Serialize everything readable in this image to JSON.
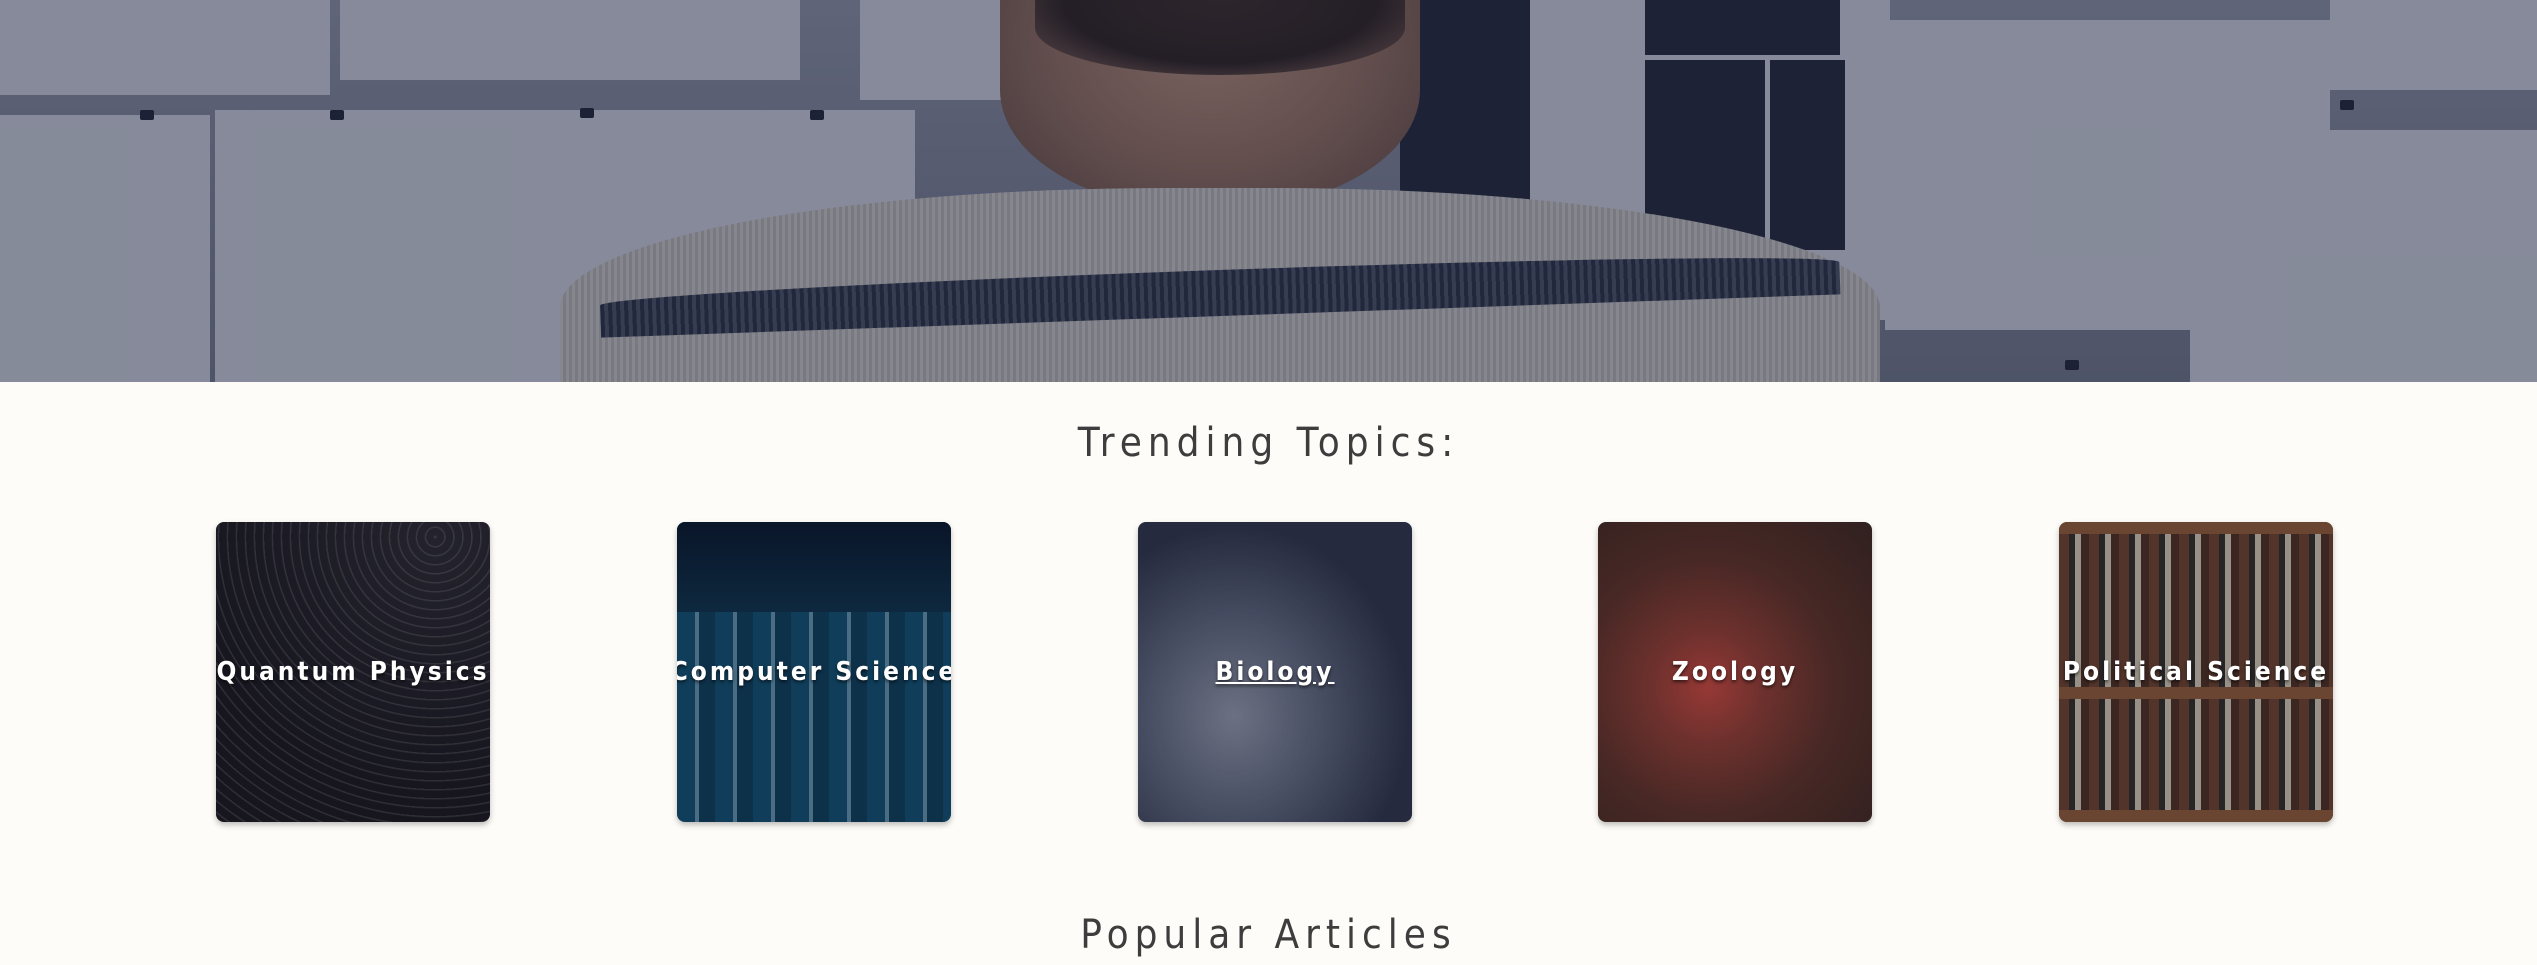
{
  "hero": {
    "alt": "Person viewing papers pinned on a wall"
  },
  "trending": {
    "heading": "Trending Topics:",
    "topics": [
      {
        "label": "Quantum Physics",
        "underlined": false
      },
      {
        "label": "Computer Science",
        "underlined": false
      },
      {
        "label": "Biology",
        "underlined": true
      },
      {
        "label": "Zoology",
        "underlined": false
      },
      {
        "label": "Political Science",
        "underlined": false
      }
    ]
  },
  "popular": {
    "heading": "Popular Articles"
  },
  "colors": {
    "page_background": "#fdfcf8",
    "heading_text": "#3d3d3d",
    "card_label": "#ffffff"
  }
}
